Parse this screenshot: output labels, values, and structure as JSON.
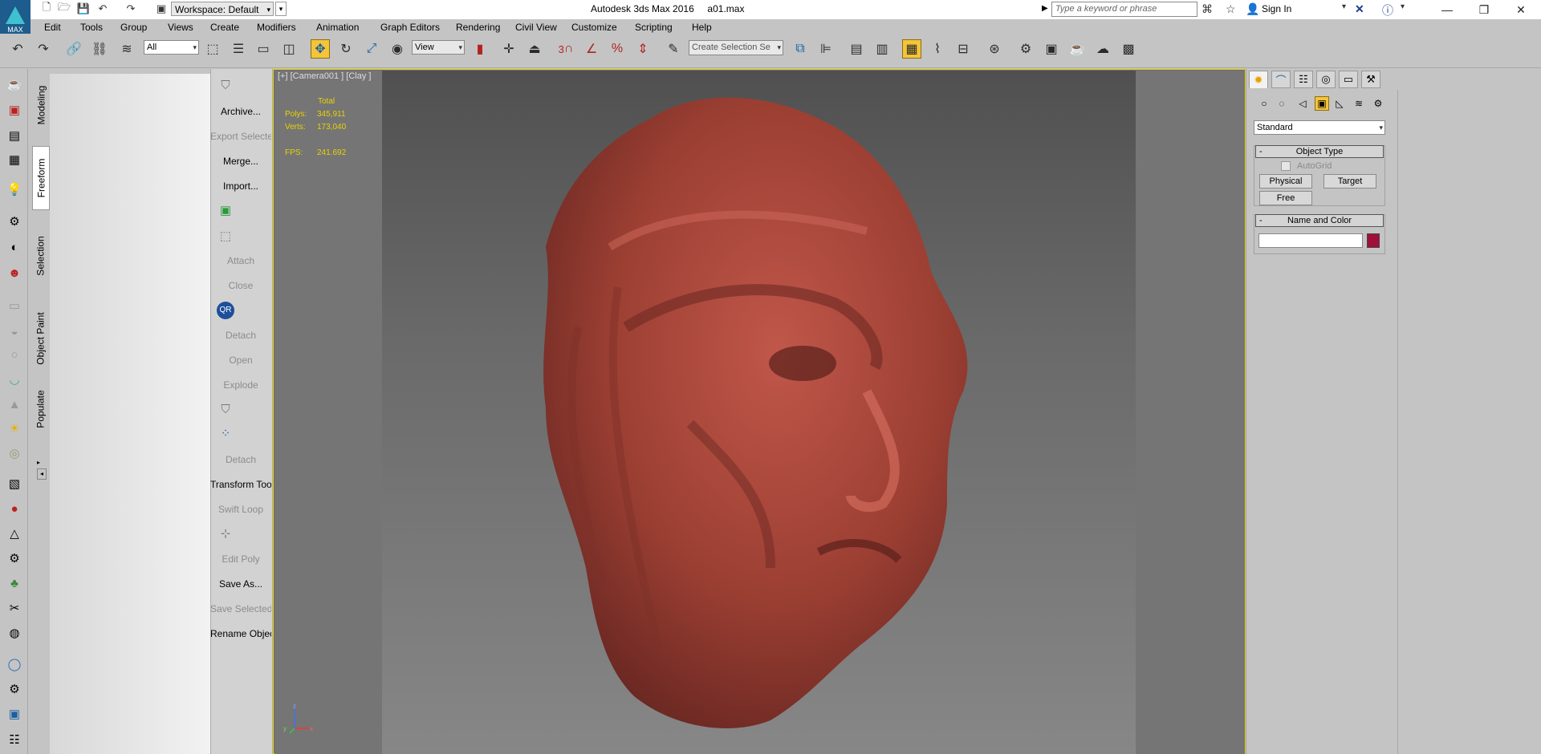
{
  "titlebar": {
    "logo_text": "MAX",
    "workspace": "Workspace: Default",
    "app_title": "Autodesk 3ds Max 2016     a01.max",
    "search_placeholder": "Type a keyword or phrase",
    "sign_in": "Sign In",
    "icons": [
      "new-file-icon",
      "open-file-icon",
      "save-icon",
      "undo-icon",
      "redo-icon",
      "project-folder-icon",
      "binoculars-icon",
      "star-icon",
      "user-icon",
      "x-exchange-icon",
      "help-icon"
    ]
  },
  "menu": [
    "Edit",
    "Tools",
    "Group",
    "Views",
    "Create",
    "Modifiers",
    "Animation",
    "Graph Editors",
    "Rendering",
    "Civil View",
    "Customize",
    "Scripting",
    "Help"
  ],
  "toolbar": {
    "selection_filter": "All",
    "ref_coord": "View",
    "named_selection_placeholder": "Create Selection Se",
    "snap_label": "3",
    "active_tool": "select-and-move"
  },
  "ribbon": {
    "tabs": [
      "Modeling",
      "Freeform",
      "Selection",
      "Object Paint",
      "Populate"
    ],
    "active_tab": "Freeform"
  },
  "commands": [
    {
      "label": "Archive...",
      "enabled": true
    },
    {
      "label": "Export Selected",
      "enabled": false
    },
    {
      "label": "Merge...",
      "enabled": true
    },
    {
      "label": "Import...",
      "enabled": true
    },
    {
      "label": "Attach",
      "enabled": false
    },
    {
      "label": "Close",
      "enabled": false
    },
    {
      "label": "Detach",
      "enabled": false
    },
    {
      "label": "Open",
      "enabled": false
    },
    {
      "label": "Explode",
      "enabled": false
    },
    {
      "label": "Detach",
      "enabled": false
    },
    {
      "label": "Transform Tool",
      "enabled": true
    },
    {
      "label": "Swift Loop",
      "enabled": false
    },
    {
      "label": "Edit Poly",
      "enabled": false
    },
    {
      "label": "Save As...",
      "enabled": true
    },
    {
      "label": "Save Selected",
      "enabled": false
    },
    {
      "label": "Rename Objects",
      "enabled": true
    }
  ],
  "qr_badge": "QR",
  "viewport": {
    "label": "[+] [Camera001 ] [Clay ]",
    "stats_header": "Total",
    "polys_label": "Polys:",
    "polys_value": "345,911",
    "verts_label": "Verts:",
    "verts_value": "173,040",
    "fps_label": "FPS:",
    "fps_value": "241.692",
    "axis_x": "x",
    "axis_y": "y",
    "axis_z": "z",
    "object_color": "#a4483a"
  },
  "command_panel": {
    "category": "Standard",
    "object_type_title": "Object Type",
    "autogrid": "AutoGrid",
    "buttons": [
      "Physical",
      "Target",
      "Free"
    ],
    "name_color_title": "Name and Color",
    "object_name": "",
    "object_color": "#a0103a"
  }
}
